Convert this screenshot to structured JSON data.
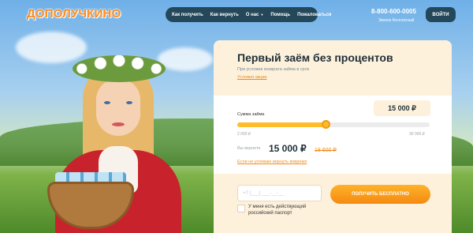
{
  "header": {
    "logo": "ДОПОЛУЧКИНО",
    "nav": [
      {
        "label": "Как получить"
      },
      {
        "label": "Как вернуть"
      },
      {
        "label": "О нас"
      },
      {
        "label": "Помощь"
      },
      {
        "label": "Пожаловаться"
      }
    ],
    "phone": "8-800-600-0005",
    "phone_note": "Звонок бесплатный",
    "login": "ВОЙТИ"
  },
  "form": {
    "title": "Первый заём без процентов",
    "condition": "При условии возврата займа в срок",
    "condition_link": "Условия акции",
    "sum_label": "Сумма займа",
    "sum_value": "15 000 ₽",
    "slider": {
      "min_label": "2 000 ₽",
      "max_label": "30 000 ₽",
      "fraction": 0.46
    },
    "return_label": "Вы вернете",
    "return_value": "15 000 ₽",
    "return_old": "18 600 ₽",
    "late_link": "Если не успеваю вернуть вовремя",
    "phone_placeholder": "+7 (___) ___-__-__",
    "cta": "ПОЛУЧИТЬ БЕСПЛАТНО",
    "checkbox_label": "У меня есть действующий российский паспорт"
  },
  "colors": {
    "accent": "#f48a12",
    "nav_bg": "#24485a",
    "card_tint": "#fdf1dc"
  }
}
